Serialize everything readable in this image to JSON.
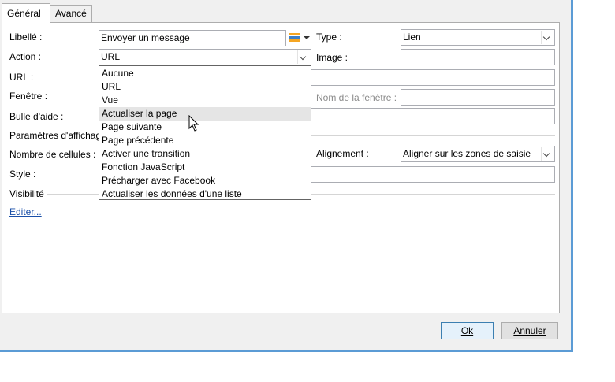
{
  "tabs": [
    {
      "label": "Général",
      "active": true
    },
    {
      "label": "Avancé",
      "active": false
    }
  ],
  "form": {
    "libelle_label": "Libellé :",
    "libelle_value": "Envoyer un message",
    "action_label": "Action :",
    "action_value": "URL",
    "url_label": "URL :",
    "fenetre_label": "Fenêtre :",
    "bulle_label": "Bulle d'aide :",
    "parametres_label": "Paramètres d'affichag",
    "nb_cellules_label": "Nombre de cellules :",
    "style_label": "Style :",
    "visibilite_label": "Visibilité",
    "editer_link": "Editer...",
    "type_label": "Type :",
    "type_value": "Lien",
    "image_label": "Image :",
    "nom_fenetre_label": "Nom de la fenêtre :",
    "alignement_label": "Alignement :",
    "alignement_value": "Aligner sur les zones de saisie"
  },
  "action_options": [
    "Aucune",
    "URL",
    "Vue",
    "Actualiser la page",
    "Page suivante",
    "Page précédente",
    "Activer une transition",
    "Fonction JavaScript",
    "Précharger avec Facebook",
    "Actualiser les données d'une liste"
  ],
  "hovered_option_index": 3,
  "buttons": {
    "ok": "Ok",
    "annuler": "Annuler"
  },
  "colors": {
    "accent_border": "#5b9bd5",
    "link": "#1a4fa8",
    "icon_orange": "#f5a623",
    "icon_blue": "#3c7fc8"
  }
}
